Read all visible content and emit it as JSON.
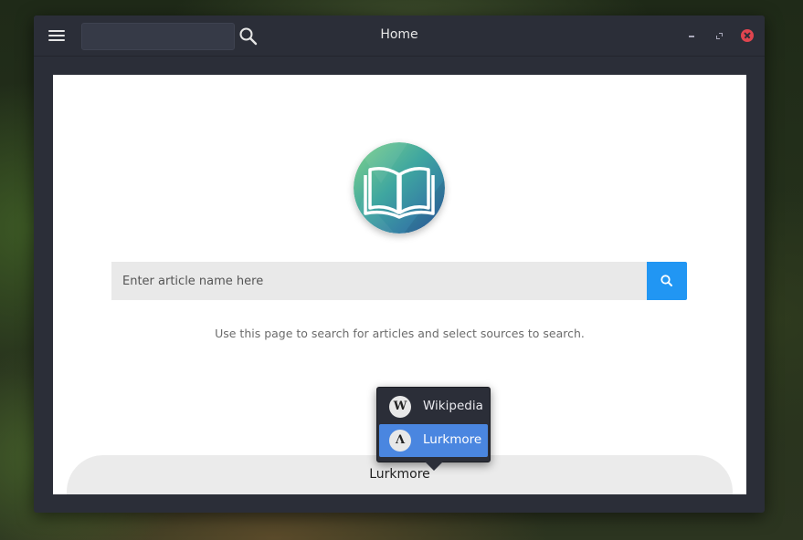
{
  "window": {
    "title": "Home",
    "top_search_value": ""
  },
  "icons": {
    "menu": "hamburger-icon",
    "top_search": "search-icon",
    "minimize": "minimize-icon",
    "maximize": "maximize-icon",
    "close": "close-icon",
    "logo": "open-book-icon",
    "search_button": "search-icon"
  },
  "search": {
    "placeholder": "Enter article name here",
    "value": ""
  },
  "hint": "Use this page to search for articles and select sources to search.",
  "sources": {
    "selected": "Lurkmore",
    "items": [
      {
        "label": "Wikipedia",
        "icon_glyph": "W",
        "icon": "wikipedia-icon"
      },
      {
        "label": "Lurkmore",
        "icon_glyph": "Λ",
        "icon": "lurkmore-icon"
      }
    ]
  },
  "colors": {
    "accent": "#2196f3",
    "selection": "#4a86e0",
    "close": "#e0454f",
    "titlebar": "#2b2e38"
  }
}
